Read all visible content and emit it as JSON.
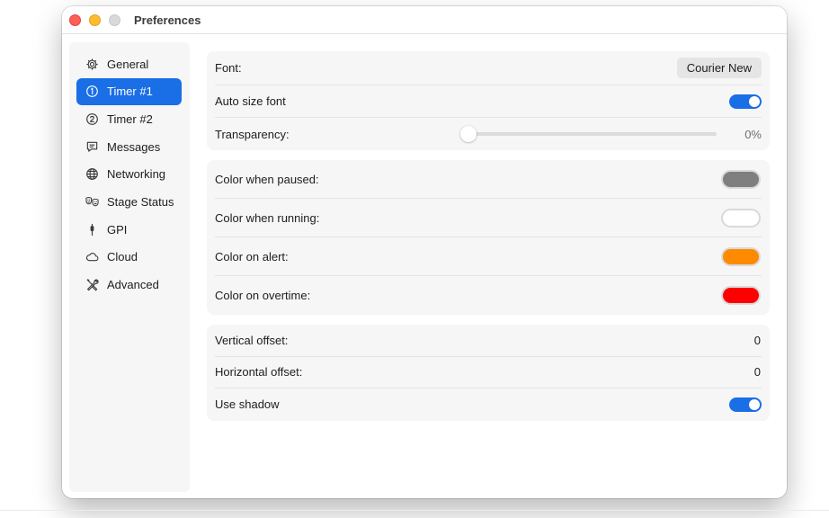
{
  "window": {
    "title": "Preferences"
  },
  "sidebar": {
    "items": [
      {
        "label": "General",
        "icon": "gear-icon"
      },
      {
        "label": "Timer #1",
        "icon": "circle-one-icon",
        "active": true
      },
      {
        "label": "Timer #2",
        "icon": "circle-two-icon"
      },
      {
        "label": "Messages",
        "icon": "message-icon"
      },
      {
        "label": "Networking",
        "icon": "globe-icon"
      },
      {
        "label": "Stage Status",
        "icon": "theater-masks-icon"
      },
      {
        "label": "GPI",
        "icon": "connector-icon"
      },
      {
        "label": "Cloud",
        "icon": "cloud-icon"
      },
      {
        "label": "Advanced",
        "icon": "tools-icon"
      }
    ]
  },
  "font_group": {
    "font_label": "Font:",
    "font_value": "Courier New",
    "auto_size_label": "Auto size font",
    "auto_size_on": true,
    "transparency_label": "Transparency:",
    "transparency_value": "0%",
    "transparency_fraction": 0
  },
  "color_group": {
    "paused_label": "Color when paused:",
    "paused_color": "#7f7f7f",
    "running_label": "Color when running:",
    "running_color": "#ffffff",
    "alert_label": "Color on alert:",
    "alert_color": "#ff8a00",
    "overtime_label": "Color on overtime:",
    "overtime_color": "#ff0000"
  },
  "offset_group": {
    "vertical_label": "Vertical offset:",
    "vertical_value": "0",
    "horizontal_label": "Horizontal offset:",
    "horizontal_value": "0",
    "shadow_label": "Use shadow",
    "shadow_on": true
  },
  "colors": {
    "accent": "#1a6ee6"
  }
}
